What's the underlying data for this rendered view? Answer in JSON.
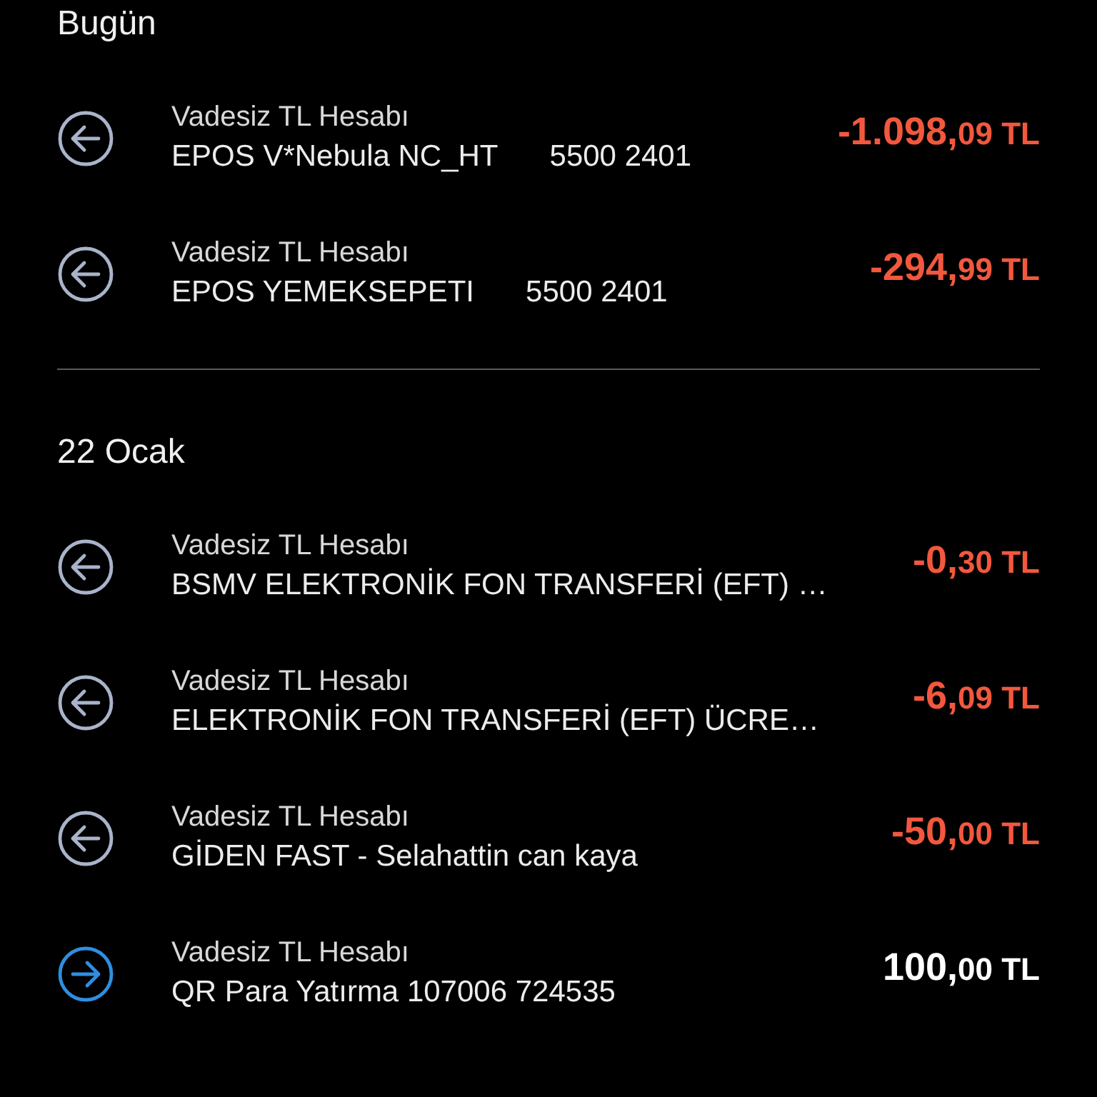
{
  "sections": [
    {
      "heading": "Bugün",
      "transactions": [
        {
          "kind": "outgoing",
          "account": "Vadesiz TL Hesabı",
          "description": "EPOS V*Nebula NC_HT",
          "reference": "5500 2401",
          "amount": "-1.098,",
          "cents": "09",
          "currency": "TL"
        },
        {
          "kind": "outgoing",
          "account": "Vadesiz TL Hesabı",
          "description": "EPOS YEMEKSEPETI",
          "reference": "5500 2401",
          "amount": "-294,",
          "cents": "99",
          "currency": "TL"
        }
      ]
    },
    {
      "heading": "22 Ocak",
      "transactions": [
        {
          "kind": "outgoing",
          "account": "Vadesiz TL Hesabı",
          "description": "BSMV ELEKTRONİK FON TRANSFERİ (EFT) …",
          "amount": "-0,",
          "cents": "30",
          "currency": "TL"
        },
        {
          "kind": "outgoing",
          "account": "Vadesiz TL Hesabı",
          "description": "ELEKTRONİK FON TRANSFERİ (EFT) ÜCRE…",
          "amount": "-6,",
          "cents": "09",
          "currency": "TL"
        },
        {
          "kind": "outgoing",
          "account": "Vadesiz TL Hesabı",
          "description": "GİDEN FAST - Selahattin can kaya",
          "amount": "-50,",
          "cents": "00",
          "currency": "TL"
        },
        {
          "kind": "incoming",
          "account": "Vadesiz TL Hesabı",
          "description": "QR Para Yatırma 107006 724535",
          "amount": "100,",
          "cents": "00",
          "currency": "TL"
        }
      ]
    }
  ]
}
